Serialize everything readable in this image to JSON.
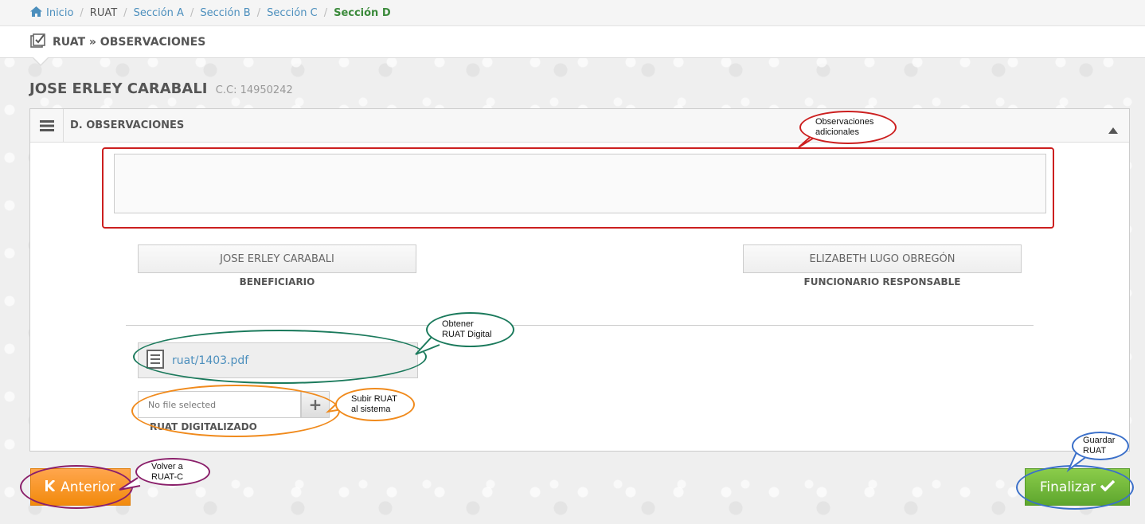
{
  "breadcrumb": {
    "items": [
      "Inicio",
      "RUAT",
      "Sección A",
      "Sección B",
      "Sección C",
      "Sección D"
    ],
    "separator": "/"
  },
  "page": {
    "title": "RUAT » OBSERVACIONES"
  },
  "person": {
    "name": "JOSE ERLEY CARABALI",
    "id": "C.C: 14950242"
  },
  "panel": {
    "title": "D. OBSERVACIONES",
    "observations_value": ""
  },
  "signatures": {
    "beneficiary": {
      "name": "JOSE ERLEY CARABALI",
      "role": "BENEFICIARIO"
    },
    "official": {
      "name": "ELIZABETH LUGO OBREGÓN",
      "role": "FUNCIONARIO RESPONSABLE"
    }
  },
  "file": {
    "link": "ruat/1403.pdf"
  },
  "upload": {
    "placeholder": "No file selected",
    "button": "+",
    "label": "RUAT DIGITALIZADO"
  },
  "buttons": {
    "prev": "Anterior",
    "finish": "Finalizar"
  },
  "callouts": {
    "observaciones": [
      "Observaciones",
      "adicionales"
    ],
    "obtener": [
      "Obtener",
      "RUAT Digital"
    ],
    "subir": [
      "Subir RUAT",
      "al sistema"
    ],
    "volver": [
      "Volver a",
      "RUAT-C"
    ],
    "guardar": [
      "Guardar",
      "RUAT"
    ]
  },
  "colors": {
    "link": "#4c8fbd",
    "active_breadcrumb": "#3b8a3b",
    "prev_button": "#f28a0c",
    "finish_button": "#5ea62e",
    "callout_red": "#cc1f1f",
    "callout_teal": "#1b7a5c",
    "callout_orange": "#f08a1c",
    "callout_purple": "#8a1f6a",
    "callout_blue": "#3a6fc9"
  },
  "icons": [
    "home-icon",
    "checklist-icon",
    "menu-icon",
    "caret-up-icon",
    "document-icon",
    "plus-icon",
    "step-backward-icon",
    "check-icon"
  ]
}
